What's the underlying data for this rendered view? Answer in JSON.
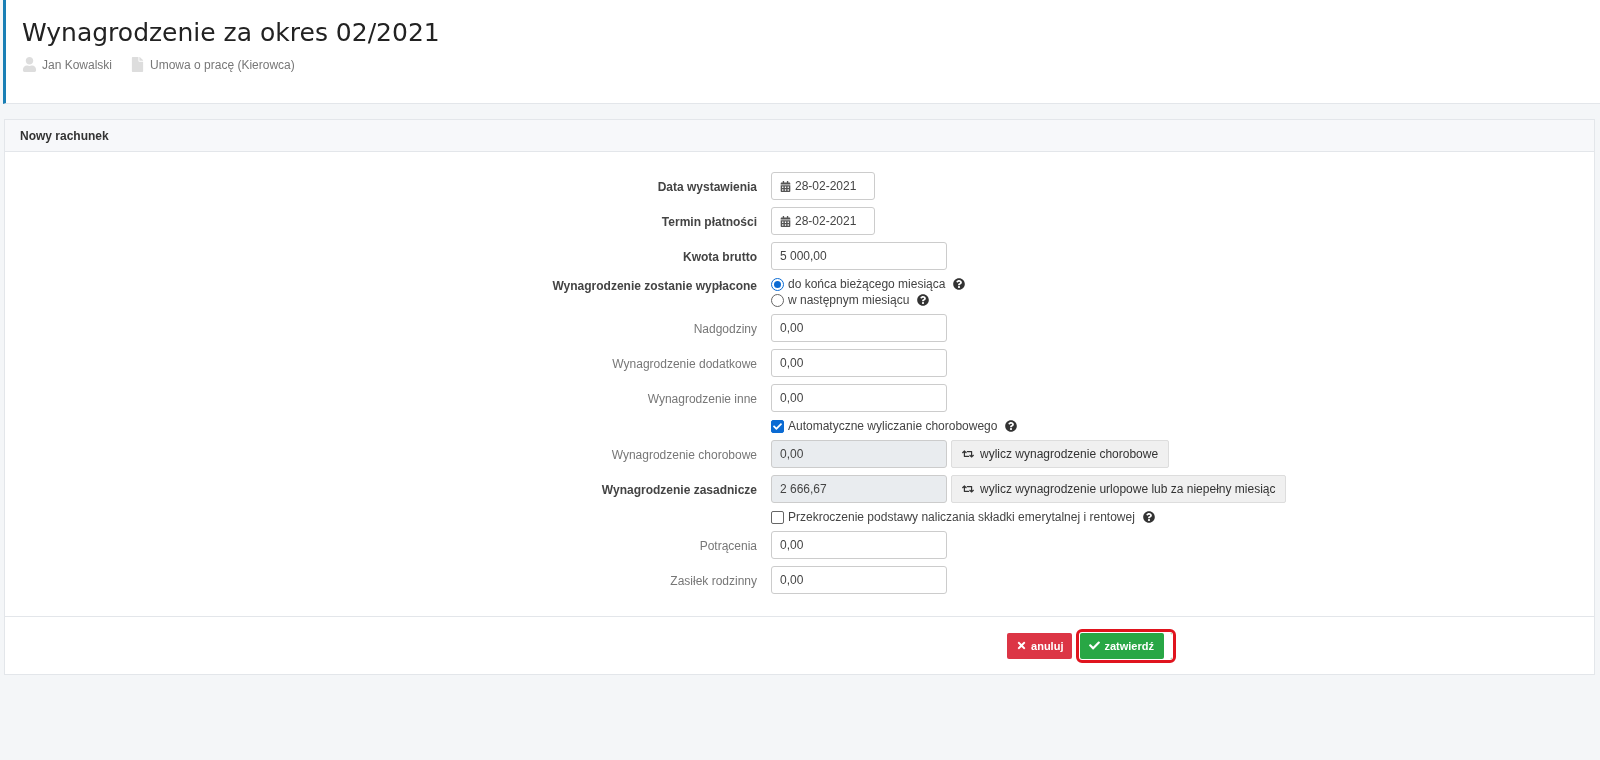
{
  "page": {
    "title": "Wynagrodzenie za okres 02/2021",
    "employee": "Jan Kowalski",
    "contract": "Umowa o pracę (Kierowca)"
  },
  "panel": {
    "title": "Nowy rachunek"
  },
  "fields": [
    {
      "kind": "date",
      "label": "Data wystawienia",
      "required": true,
      "value": "28-02-2021"
    },
    {
      "kind": "date",
      "label": "Termin płatności",
      "required": true,
      "value": "28-02-2021"
    },
    {
      "kind": "text",
      "label": "Kwota brutto",
      "required": true,
      "value": "5 000,00"
    },
    {
      "kind": "radio",
      "label": "Wynagrodzenie zostanie wypłacone",
      "required": true,
      "options": [
        {
          "label": "do końca bieżącego miesiąca",
          "selected": true
        },
        {
          "label": "w następnym miesiącu",
          "selected": false
        }
      ]
    },
    {
      "kind": "text",
      "label": "Nadgodziny",
      "required": false,
      "value": "0,00"
    },
    {
      "kind": "text",
      "label": "Wynagrodzenie dodatkowe",
      "required": false,
      "value": "0,00"
    },
    {
      "kind": "text",
      "label": "Wynagrodzenie inne",
      "required": false,
      "value": "0,00"
    },
    {
      "kind": "checkbox",
      "label": "Automatyczne wyliczanie chorobowego",
      "checked": true
    },
    {
      "kind": "computed",
      "label": "Wynagrodzenie chorobowe",
      "required": false,
      "value": "0,00",
      "action": "wylicz wynagrodzenie chorobowe"
    },
    {
      "kind": "computed",
      "label": "Wynagrodzenie zasadnicze",
      "required": true,
      "value": "2 666,67",
      "action": "wylicz wynagrodzenie urlopowe lub za niepełny miesiąc"
    },
    {
      "kind": "checkbox",
      "label": "Przekroczenie podstawy naliczania składki emerytalnej i rentowej",
      "checked": false
    },
    {
      "kind": "text",
      "label": "Potrącenia",
      "required": false,
      "value": "0,00"
    },
    {
      "kind": "text",
      "label": "Zasiłek rodzinny",
      "required": false,
      "value": "0,00"
    }
  ],
  "buttons": [
    {
      "kind": "cancel",
      "label": "anuluj",
      "highlighted": false
    },
    {
      "kind": "confirm",
      "label": "zatwierdź",
      "highlighted": true
    }
  ]
}
